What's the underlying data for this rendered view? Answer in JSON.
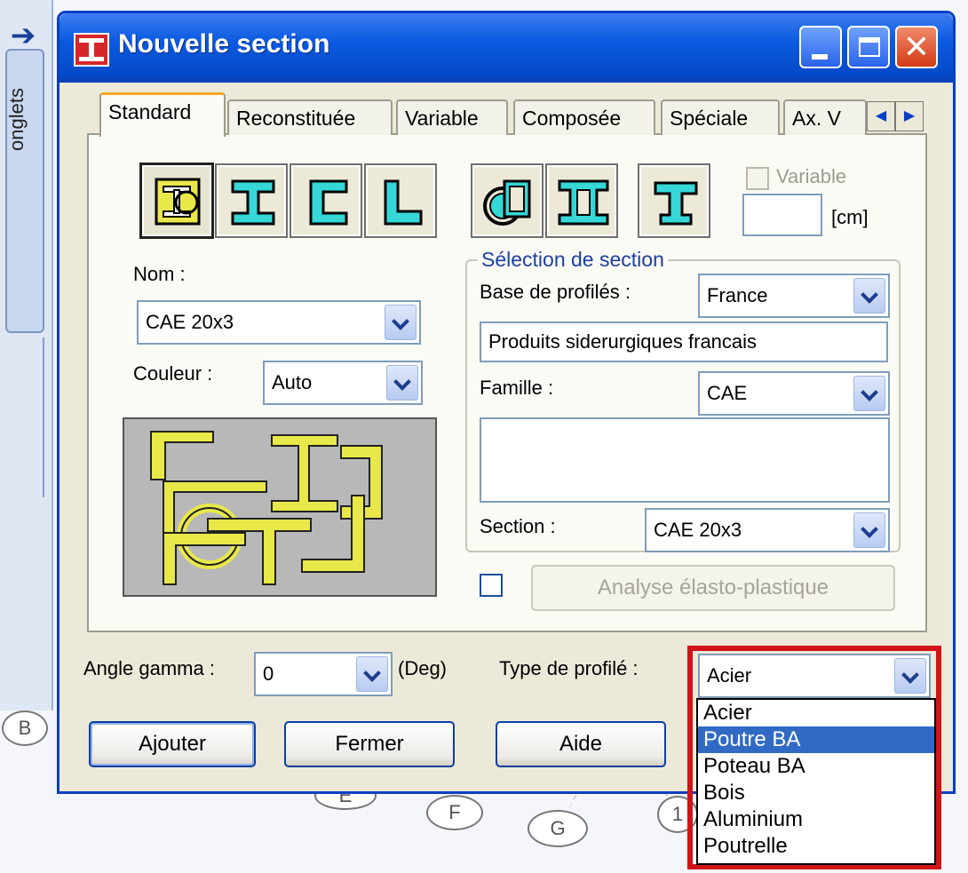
{
  "side_panel": {
    "tab_label": "onglets"
  },
  "background": {
    "markers": [
      "B",
      "E",
      "F",
      "G",
      "1"
    ]
  },
  "window": {
    "title": "Nouvelle section",
    "buttons": [
      "minimize",
      "maximize",
      "close"
    ]
  },
  "tabs": [
    "Standard",
    "Reconstituée",
    "Variable",
    "Composée",
    "Spéciale",
    "Ax. V"
  ],
  "active_tab": "Standard",
  "section_types": [
    "combined-section-icon",
    "i-beam-icon",
    "channel-icon",
    "angle-icon",
    "tube-icon",
    "double-channel-icon",
    "tee-icon"
  ],
  "variable": {
    "label": "Variable",
    "checked": false,
    "value": "",
    "unit": "[cm]"
  },
  "nom": {
    "label": "Nom :",
    "value": "CAE 20x3"
  },
  "couleur": {
    "label": "Couleur :",
    "value": "Auto"
  },
  "selection": {
    "title": "Sélection de section",
    "base_label": "Base de profilés :",
    "base_value": "France",
    "base_description": "Produits siderurgiques francais",
    "famille_label": "Famille :",
    "famille_value": "CAE",
    "section_label": "Section :",
    "section_value": "CAE 20x3"
  },
  "analyse": {
    "checked": false,
    "label": "Analyse élasto-plastique"
  },
  "angle": {
    "label": "Angle gamma :",
    "value": "0",
    "unit": "(Deg)"
  },
  "type_profile": {
    "label": "Type de profilé :",
    "value": "Acier",
    "options": [
      "Acier",
      "Poutre BA",
      "Poteau BA",
      "Bois",
      "Aluminium",
      "Poutrelle"
    ],
    "highlighted": "Poutre BA"
  },
  "buttons": {
    "ajouter": "Ajouter",
    "fermer": "Fermer",
    "aide": "Aide"
  },
  "colors": {
    "title_bar": "#0a5ae0",
    "highlight": "#316ac5",
    "annotation_frame": "#d01417",
    "section_fill": "#e8e84a",
    "icon_fill": "#35d7d7"
  }
}
